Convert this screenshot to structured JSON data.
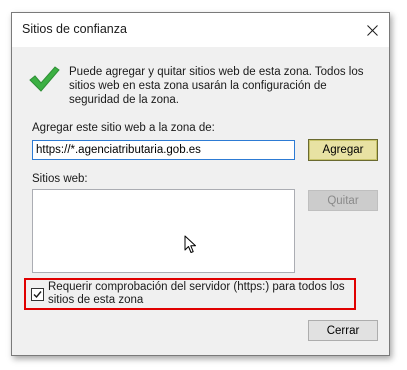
{
  "window": {
    "title": "Sitios de confianza",
    "close_icon": "close-icon"
  },
  "info": {
    "icon": "checkmark-icon",
    "text": "Puede agregar y quitar sitios web de esta zona. Todos los sitios web en esta zona usarán la configuración de seguridad de la zona."
  },
  "add_site": {
    "label": "Agregar este sitio web a la zona de:",
    "value": "https://*.agenciatributaria.gob.es",
    "button_label": "Agregar"
  },
  "websites": {
    "label": "Sitios web:",
    "items": [],
    "remove_button_label": "Quitar",
    "remove_button_enabled": false
  },
  "https_option": {
    "checked": true,
    "label": "Requerir comprobación del servidor (https:) para todos los sitios de esta zona",
    "highlight_color": "#e00000"
  },
  "footer": {
    "close_button_label": "Cerrar"
  },
  "colors": {
    "accent": "#2d7bd4",
    "checkmark": "#3cb043",
    "default_button": "#e8e2a3"
  }
}
